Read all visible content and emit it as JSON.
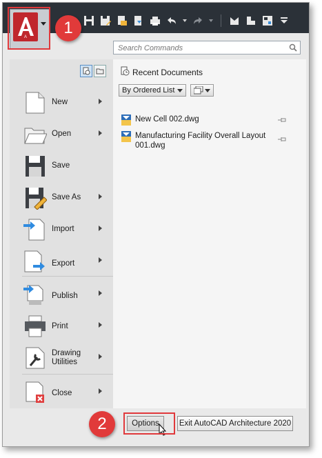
{
  "quick_access": {
    "icons": [
      "save-icon",
      "save-as-icon",
      "open-from-web-icon",
      "save-to-web-icon",
      "plot-icon",
      "undo-icon",
      "redo-icon",
      "share-icon",
      "design-feed-icon",
      "workspace-icon",
      "customize-icon"
    ]
  },
  "callouts": {
    "one": "1",
    "two": "2"
  },
  "search": {
    "placeholder": "Search Commands"
  },
  "left_menu": {
    "items": [
      {
        "label": "New",
        "icon": "new-document-icon",
        "submenu": true
      },
      {
        "label": "Open",
        "icon": "open-folder-icon",
        "submenu": true
      },
      {
        "label": "Save",
        "icon": "save-disk-icon",
        "submenu": false
      },
      {
        "label": "Save As",
        "icon": "save-as-disk-icon",
        "submenu": true
      },
      {
        "label": "Import",
        "icon": "import-icon",
        "submenu": true
      },
      {
        "label": "Export",
        "icon": "export-icon",
        "submenu": true
      },
      {
        "label": "Publish",
        "icon": "publish-icon",
        "submenu": true
      },
      {
        "label": "Print",
        "icon": "printer-icon",
        "submenu": true
      },
      {
        "label": "Drawing Utilities",
        "icon": "wrench-icon",
        "submenu": true
      },
      {
        "label": "Close",
        "icon": "close-document-icon",
        "submenu": true
      }
    ]
  },
  "recent": {
    "title": "Recent Documents",
    "sort_label": "By Ordered List",
    "documents": [
      {
        "name": "New Cell 002.dwg"
      },
      {
        "name": "Manufacturing Facility Overall Layout 001.dwg"
      }
    ]
  },
  "footer": {
    "options_label": "Options",
    "exit_label": "Exit AutoCAD Architecture 2020"
  },
  "colors": {
    "accent_red": "#e13a3a",
    "titlebar": "#2b3138"
  }
}
